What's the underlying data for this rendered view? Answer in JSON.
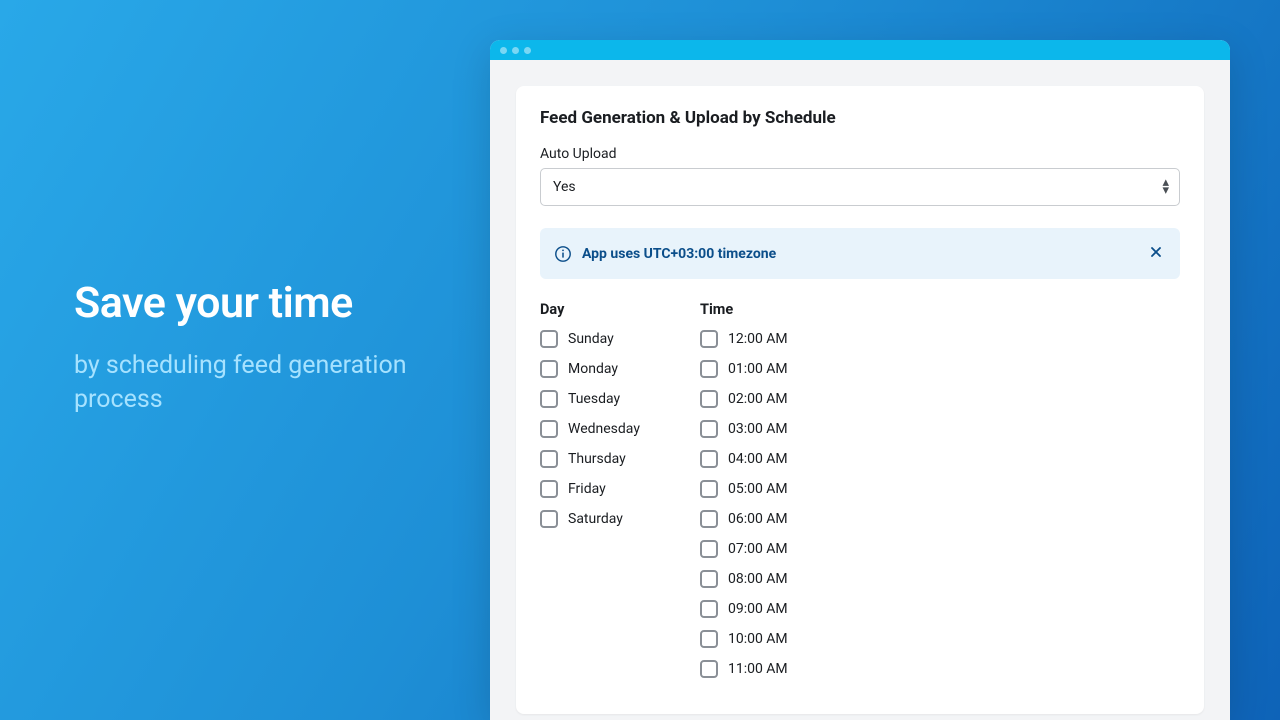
{
  "marketing": {
    "headline": "Save your time",
    "subhead": "by scheduling feed generation process"
  },
  "card": {
    "title": "Feed Generation & Upload by Schedule",
    "auto_upload_label": "Auto Upload",
    "auto_upload_value": "Yes"
  },
  "banner": {
    "text": "App uses UTC+03:00 timezone"
  },
  "columns": {
    "day_header": "Day",
    "time_header": "Time"
  },
  "days": [
    {
      "label": "Sunday"
    },
    {
      "label": "Monday"
    },
    {
      "label": "Tuesday"
    },
    {
      "label": "Wednesday"
    },
    {
      "label": "Thursday"
    },
    {
      "label": "Friday"
    },
    {
      "label": "Saturday"
    }
  ],
  "times": [
    {
      "label": "12:00 AM"
    },
    {
      "label": "01:00 AM"
    },
    {
      "label": "02:00 AM"
    },
    {
      "label": "03:00 AM"
    },
    {
      "label": "04:00 AM"
    },
    {
      "label": "05:00 AM"
    },
    {
      "label": "06:00 AM"
    },
    {
      "label": "07:00 AM"
    },
    {
      "label": "08:00 AM"
    },
    {
      "label": "09:00 AM"
    },
    {
      "label": "10:00 AM"
    },
    {
      "label": "11:00 AM"
    }
  ]
}
